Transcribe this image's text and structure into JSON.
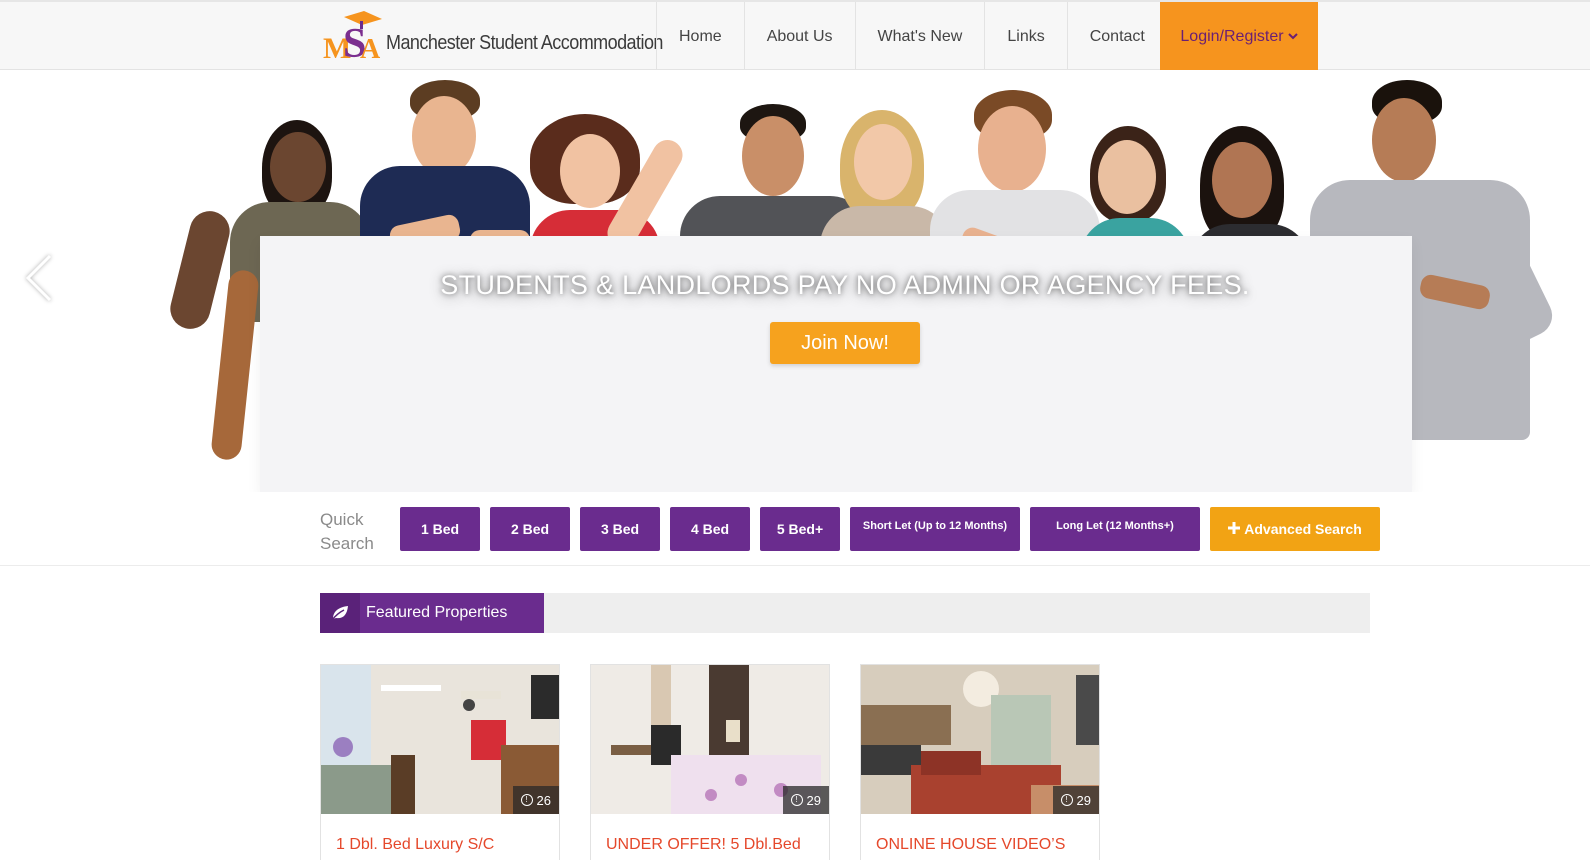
{
  "header": {
    "logo_letters": "MSA",
    "logo_text": "Manchester Student Accommodation",
    "nav": [
      "Home",
      "About Us",
      "What's New",
      "Links",
      "Contact"
    ],
    "login_label": "Login/Register",
    "login_icon": "chevron-down-icon"
  },
  "hero": {
    "title": "STUDENTS & LANDLORDS PAY NO ADMIN OR AGENCY FEES.",
    "join_button": "Join Now!"
  },
  "quick_search": {
    "label": "Quick Search",
    "buttons": [
      "1 Bed",
      "2 Bed",
      "3 Bed",
      "4 Bed",
      "5 Bed+",
      "Short Let (Up to 12 Months)",
      "Long Let (12 Months+)"
    ],
    "advanced_icon": "plus-icon",
    "advanced_label": "Advanced Search"
  },
  "featured": {
    "icon": "leaf-icon",
    "title": "Featured Properties",
    "cards": [
      {
        "photo_count": "26",
        "title": "1 Dbl. Bed Luxury S/C"
      },
      {
        "photo_count": "29",
        "title": "UNDER OFFER! 5 Dbl.Bed"
      },
      {
        "photo_count": "29",
        "title": "ONLINE HOUSE VIDEO’S"
      }
    ]
  },
  "colors": {
    "brand_purple": "#6a2c8e",
    "brand_orange": "#f6941e",
    "link_red": "#e5482b"
  }
}
